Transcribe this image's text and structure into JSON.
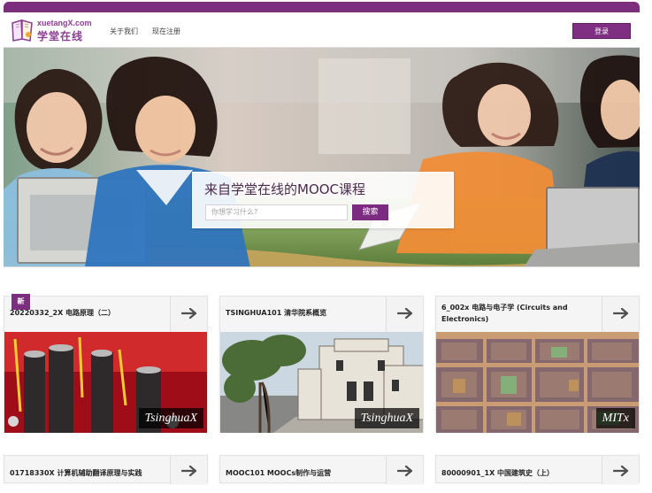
{
  "header": {
    "logo_url": "xuetangX.com",
    "logo_cn": "学堂在线",
    "nav": [
      "关于我们",
      "现在注册"
    ],
    "login_label": "登录"
  },
  "hero": {
    "title": "来自学堂在线的MOOC课程",
    "search_placeholder": "你想学习什么?",
    "search_button": "搜索"
  },
  "courses": [
    {
      "title": "20220332_2X 电路原理（二）",
      "badge": "新",
      "brand": "TsinghuaX"
    },
    {
      "title": "TSINGHUA101 清华院系概览",
      "brand": "TsinghuaX"
    },
    {
      "title": "6_002x 电路与电子学 (Circuits and Electronics)",
      "brand": "MITx"
    }
  ],
  "courses_row2": [
    {
      "title": "01718330X 计算机辅助翻译原理与实践"
    },
    {
      "title": "MOOC101 MOOCs制作与运营"
    },
    {
      "title": "80000901_1X 中国建筑史（上）"
    }
  ],
  "colors": {
    "accent": "#7d2f7d",
    "button": "#7b2c80",
    "card_bg": "#f5f5f5"
  }
}
